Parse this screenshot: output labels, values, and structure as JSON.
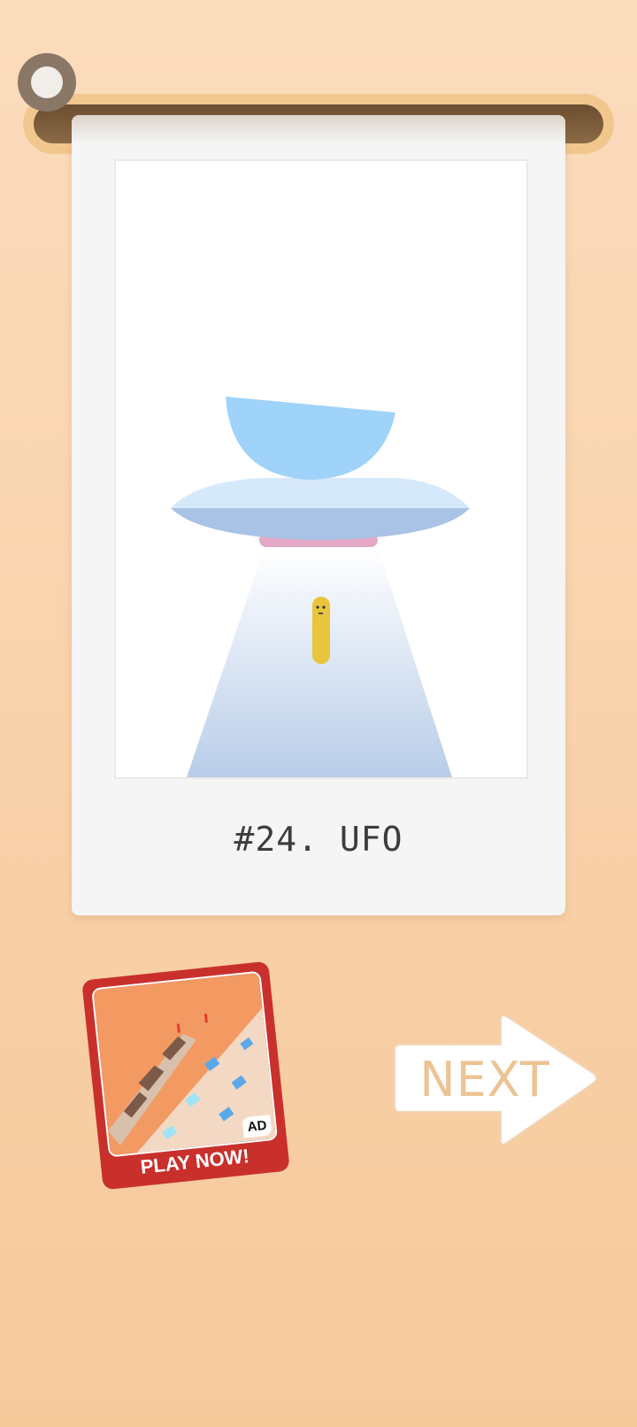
{
  "background": {
    "gradient_top": "#fbdcbd",
    "gradient_bottom": "#f6c99b"
  },
  "menu": {
    "icon": "circle-menu-icon"
  },
  "polaroid": {
    "caption": "#24. UFO",
    "scene": {
      "subject": "ufo-beam-icon",
      "colors": {
        "dome": "#9fd3fa",
        "saucer_top": "#d6e9fb",
        "saucer_bottom": "#a9c3e6",
        "ring": "#e4a9c6",
        "beam_top": "#ffffff",
        "beam_bottom": "#b9cde9",
        "character": "#e8c53c"
      }
    }
  },
  "ad": {
    "badge": "AD",
    "cta": "PLAY NOW!",
    "frame_color": "#c9302c"
  },
  "next_button": {
    "label": "NEXT",
    "icon": "arrow-right-icon",
    "label_color": "#edc394"
  }
}
